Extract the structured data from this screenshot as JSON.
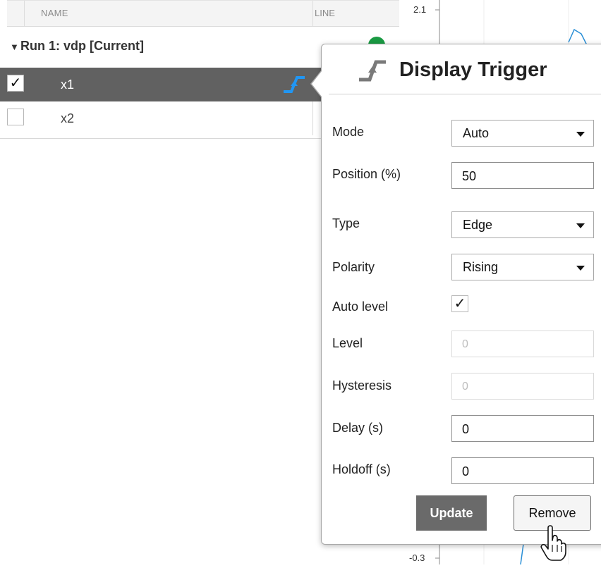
{
  "table": {
    "header": {
      "name": "NAME",
      "line": "LINE"
    },
    "run": {
      "label": "Run 1: vdp [Current]",
      "line_color": "#1a9a43"
    },
    "signals": [
      {
        "name": "x1",
        "checked": true,
        "selected": true,
        "checkmark": "✓",
        "icon": "trigger-icon"
      },
      {
        "name": "x2",
        "checked": false,
        "selected": false,
        "checkmark": ""
      }
    ]
  },
  "plot": {
    "y_top_tick": "2.1",
    "y_bottom_tick": "-0.3",
    "line_color": "#2a8fd6"
  },
  "popup": {
    "title": "Display Trigger",
    "title_icon": "trigger-icon",
    "fields": {
      "mode": {
        "label": "Mode",
        "value": "Auto"
      },
      "position": {
        "label": "Position (%)",
        "value": "50"
      },
      "type": {
        "label": "Type",
        "value": "Edge"
      },
      "polarity": {
        "label": "Polarity",
        "value": "Rising"
      },
      "auto_level": {
        "label": "Auto level",
        "checked": true,
        "checkmark": "✓"
      },
      "level": {
        "label": "Level",
        "value": "0",
        "disabled": true
      },
      "hysteresis": {
        "label": "Hysteresis",
        "value": "0",
        "disabled": true
      },
      "delay": {
        "label": "Delay (s)",
        "value": "0"
      },
      "holdoff": {
        "label": "Holdoff (s)",
        "value": "0"
      }
    },
    "buttons": {
      "update": "Update",
      "remove": "Remove"
    }
  },
  "colors": {
    "selected_row": "#616161",
    "trigger_icon_blue": "#2196f3",
    "update_button": "#6a6a6a"
  }
}
